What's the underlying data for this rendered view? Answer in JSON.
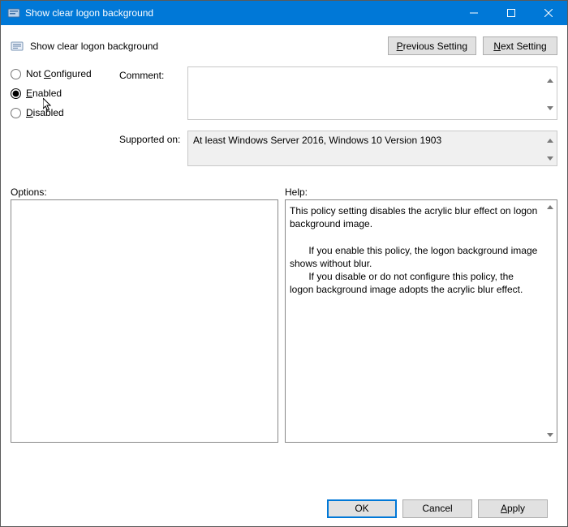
{
  "window": {
    "title": "Show clear logon background"
  },
  "header": {
    "policy_title": "Show clear logon background",
    "prev_btn_text": "Previous Setting",
    "prev_btn_key": "P",
    "next_btn_text": "Next Setting",
    "next_btn_key": "N"
  },
  "state": {
    "not_configured_label": "Not Configured",
    "not_configured_key": "C",
    "enabled_label": "Enabled",
    "enabled_key": "E",
    "disabled_label": "Disabled",
    "disabled_key": "D",
    "selected": "enabled"
  },
  "comment": {
    "label": "Comment:",
    "value": ""
  },
  "supported": {
    "label": "Supported on:",
    "value": "At least Windows Server 2016, Windows 10 Version 1903"
  },
  "options": {
    "label": "Options:"
  },
  "help": {
    "label": "Help:",
    "text": "This policy setting disables the acrylic blur effect on logon background image.\n\n       If you enable this policy, the logon background image shows without blur.\n       If you disable or do not configure this policy, the logon background image adopts the acrylic blur effect."
  },
  "footer": {
    "ok": "OK",
    "cancel": "Cancel",
    "apply_text": "Apply",
    "apply_key": "A"
  }
}
